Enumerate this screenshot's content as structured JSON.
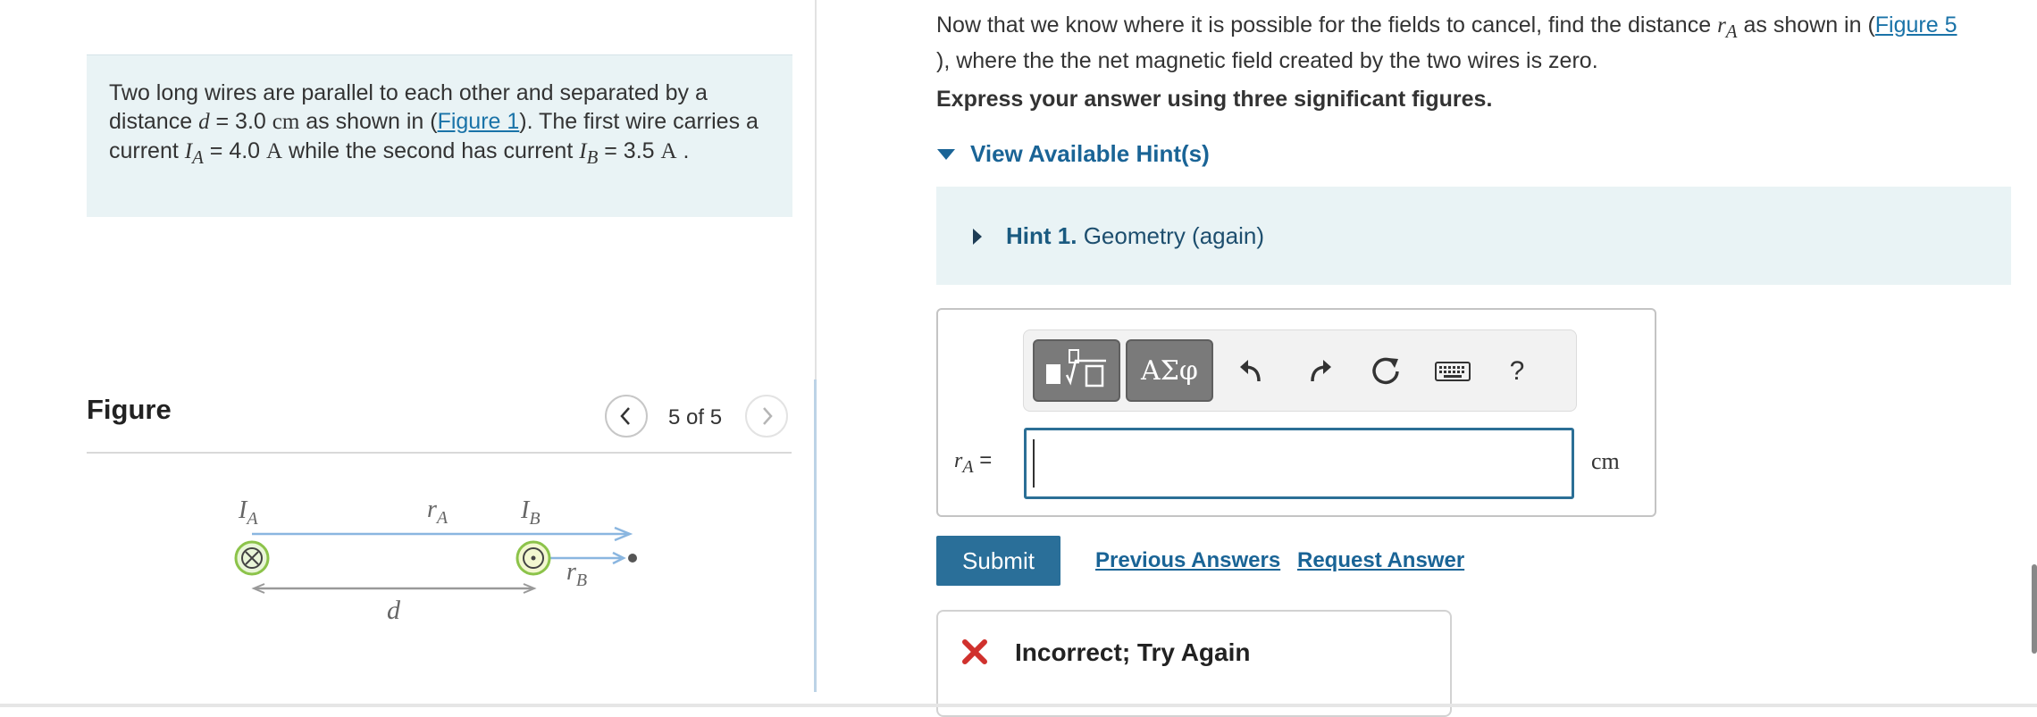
{
  "problem": {
    "t1": "Two long wires are parallel to each other and separated by a distance ",
    "var_d": "d",
    "t2": " = 3.0 ",
    "unit_cm": "cm",
    "t3": " as shown in (",
    "fig_link": "Figure 1",
    "t4": ").  The first wire carries a current ",
    "var_I": "I",
    "sub_A": "A",
    "t5": " = 4.0 ",
    "unit_A": "A",
    "t6": " while the second has current ",
    "sub_B": "B",
    "t7": " = 3.5 ",
    "t8": " ."
  },
  "figure": {
    "title": "Figure",
    "pager": "5 of 5",
    "labels": {
      "IA_main": "I",
      "IA_sub": "A",
      "rA_main": "r",
      "rA_sub": "A",
      "IB_main": "I",
      "IB_sub": "B",
      "rB_main": "r",
      "rB_sub": "B",
      "d": "d"
    }
  },
  "question": {
    "t1": "Now that we know where it is possible for the fields to cancel, find the distance ",
    "var_r": "r",
    "sub_A": "A",
    "t2": " as shown in (",
    "fig_link": "Figure 5",
    "t3": "), where the the net magnetic field created by the two wires is zero."
  },
  "instruction": "Express your answer using three significant figures.",
  "hints": {
    "toggle_label": "View Available Hint(s)",
    "hint1_num": "Hint 1.",
    "hint1_text": "Geometry (again)"
  },
  "toolbar": {
    "greek_label": "ΑΣφ",
    "help_label": "?",
    "icons": [
      "templates-icon",
      "undo-icon",
      "redo-icon",
      "reset-icon",
      "keyboard-icon"
    ]
  },
  "answer": {
    "label_var": "r",
    "label_sub": "A",
    "label_eq": " =",
    "value": "",
    "unit": "cm"
  },
  "actions": {
    "submit": "Submit",
    "previous_answers": "Previous Answers",
    "request_answer": "Request Answer"
  },
  "feedback": {
    "text": "Incorrect; Try Again",
    "icon": "x-icon",
    "color": "#d0312d"
  },
  "colors": {
    "accent": "#2a6f99",
    "link": "#1a6496",
    "panel_bg": "#e9f3f5"
  }
}
